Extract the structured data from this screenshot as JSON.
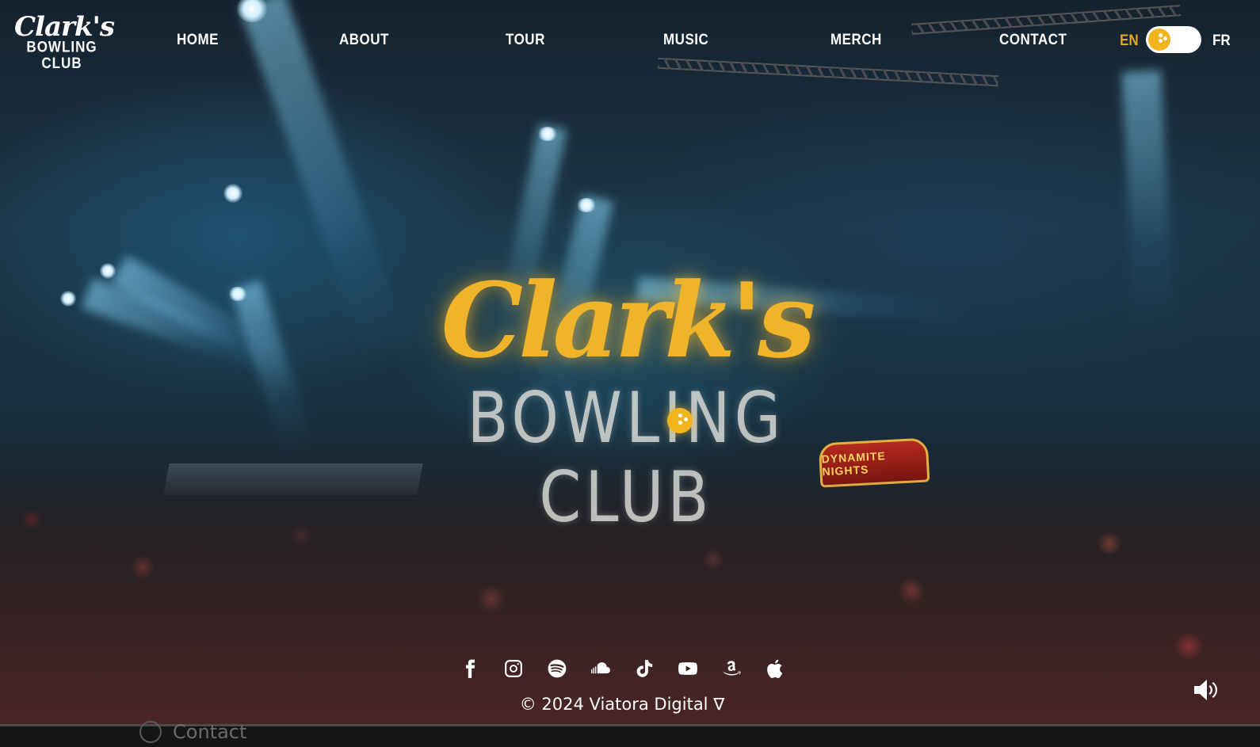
{
  "brand": {
    "logo_script": "Clark's",
    "logo_sub": "BOWLING CLUB"
  },
  "nav": {
    "items": [
      {
        "label": "HOME"
      },
      {
        "label": "ABOUT"
      },
      {
        "label": "TOUR"
      },
      {
        "label": "MUSIC"
      },
      {
        "label": "MERCH"
      },
      {
        "label": "CONTACT"
      }
    ]
  },
  "language": {
    "current": "EN",
    "other": "FR",
    "toggle_color": "#f2b51e",
    "active_color": "#e8a71d"
  },
  "hero": {
    "title_script": "Clark's",
    "title_sub": "BOWLING CLUB",
    "sign_text": "DYNAMITE NIGHTS"
  },
  "social": {
    "icons": [
      "facebook-icon",
      "instagram-icon",
      "spotify-icon",
      "soundcloud-icon",
      "tiktok-icon",
      "youtube-icon",
      "amazon-icon",
      "apple-icon"
    ]
  },
  "footer": {
    "copyright": "© 2024  Viatora Digital ∇"
  },
  "below_fold": {
    "peek_label": "Contact"
  }
}
